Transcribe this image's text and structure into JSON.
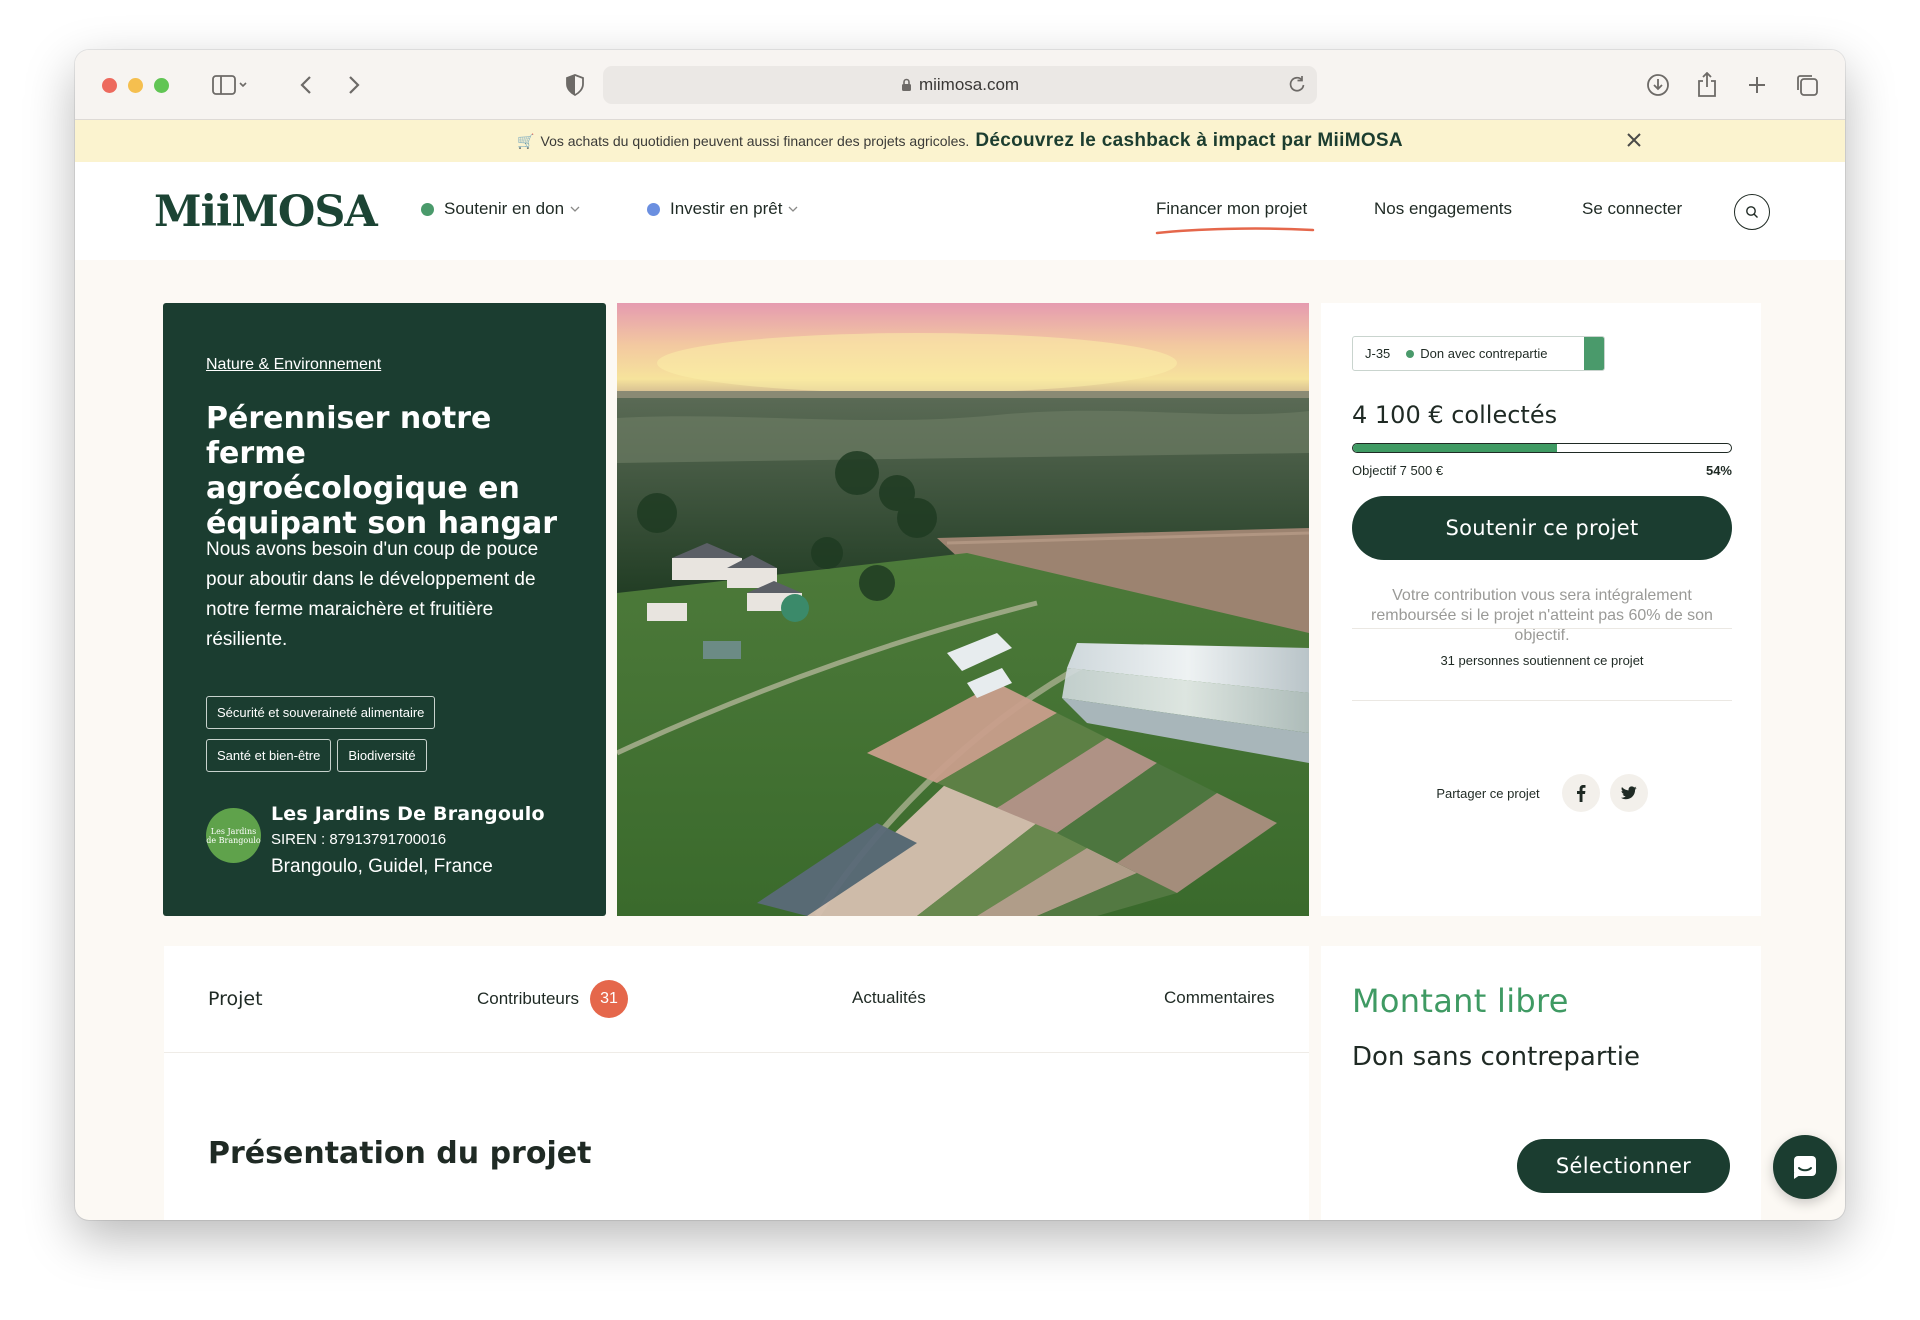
{
  "browser": {
    "url": "miimosa.com"
  },
  "banner": {
    "emoji": "🛒",
    "small_text": "Vos achats du quotidien peuvent aussi financer des projets agricoles.",
    "highlight_text": "Découvrez le cashback à impact par MiiMOSA"
  },
  "header": {
    "logo_text": "MiiMOSA",
    "nav_left": [
      {
        "label": "Soutenir en don",
        "dot_color": "#4a9a6b"
      },
      {
        "label": "Investir en prêt",
        "dot_color": "#6b8fe0"
      }
    ],
    "nav_right": [
      "Financer mon projet",
      "Nos engagements",
      "Se connecter"
    ],
    "active_underline_color": "#e5674b"
  },
  "project": {
    "category": "Nature & Environnement",
    "title": "Pérenniser notre ferme agroécologique en équipant son hangar",
    "description": "Nous avons besoin d'un coup de pouce pour aboutir dans le développement de notre ferme maraichère et fruitière résiliente.",
    "tags": [
      "Sécurité et souveraineté alimentaire",
      "Santé et bien-être",
      "Biodiversité"
    ],
    "organization": {
      "logo_text": "Les Jardins de Brangoulo",
      "name": "Les Jardins De Brangoulo",
      "siren": "SIREN : 87913791700016",
      "location": "Brangoulo, Guidel, France"
    }
  },
  "funding": {
    "days_left": "J-35",
    "type": "Don avec contrepartie",
    "collected": "4 100 € collectés",
    "goal": "Objectif 7 500 €",
    "percent": "54%",
    "progress_fraction": 0.54,
    "cta": "Soutenir ce projet",
    "refund_notice": "Votre contribution vous sera intégralement remboursée si le projet n'atteint pas 60% de son objectif.",
    "supporters": "31 personnes soutiennent ce projet",
    "share_label": "Partager ce projet"
  },
  "tabs": {
    "items": [
      "Projet",
      "Contributeurs",
      "Actualités",
      "Commentaires"
    ],
    "contributors_count": "31"
  },
  "content": {
    "section_title": "Présentation du projet"
  },
  "reward": {
    "title": "Montant libre",
    "subtitle": "Don sans contrepartie",
    "cta": "Sélectionner"
  },
  "colors": {
    "brand_green": "#1b3d30",
    "accent_green": "#3f9a63",
    "banner_bg": "#fbf3cf",
    "badge_red": "#e5674b"
  }
}
